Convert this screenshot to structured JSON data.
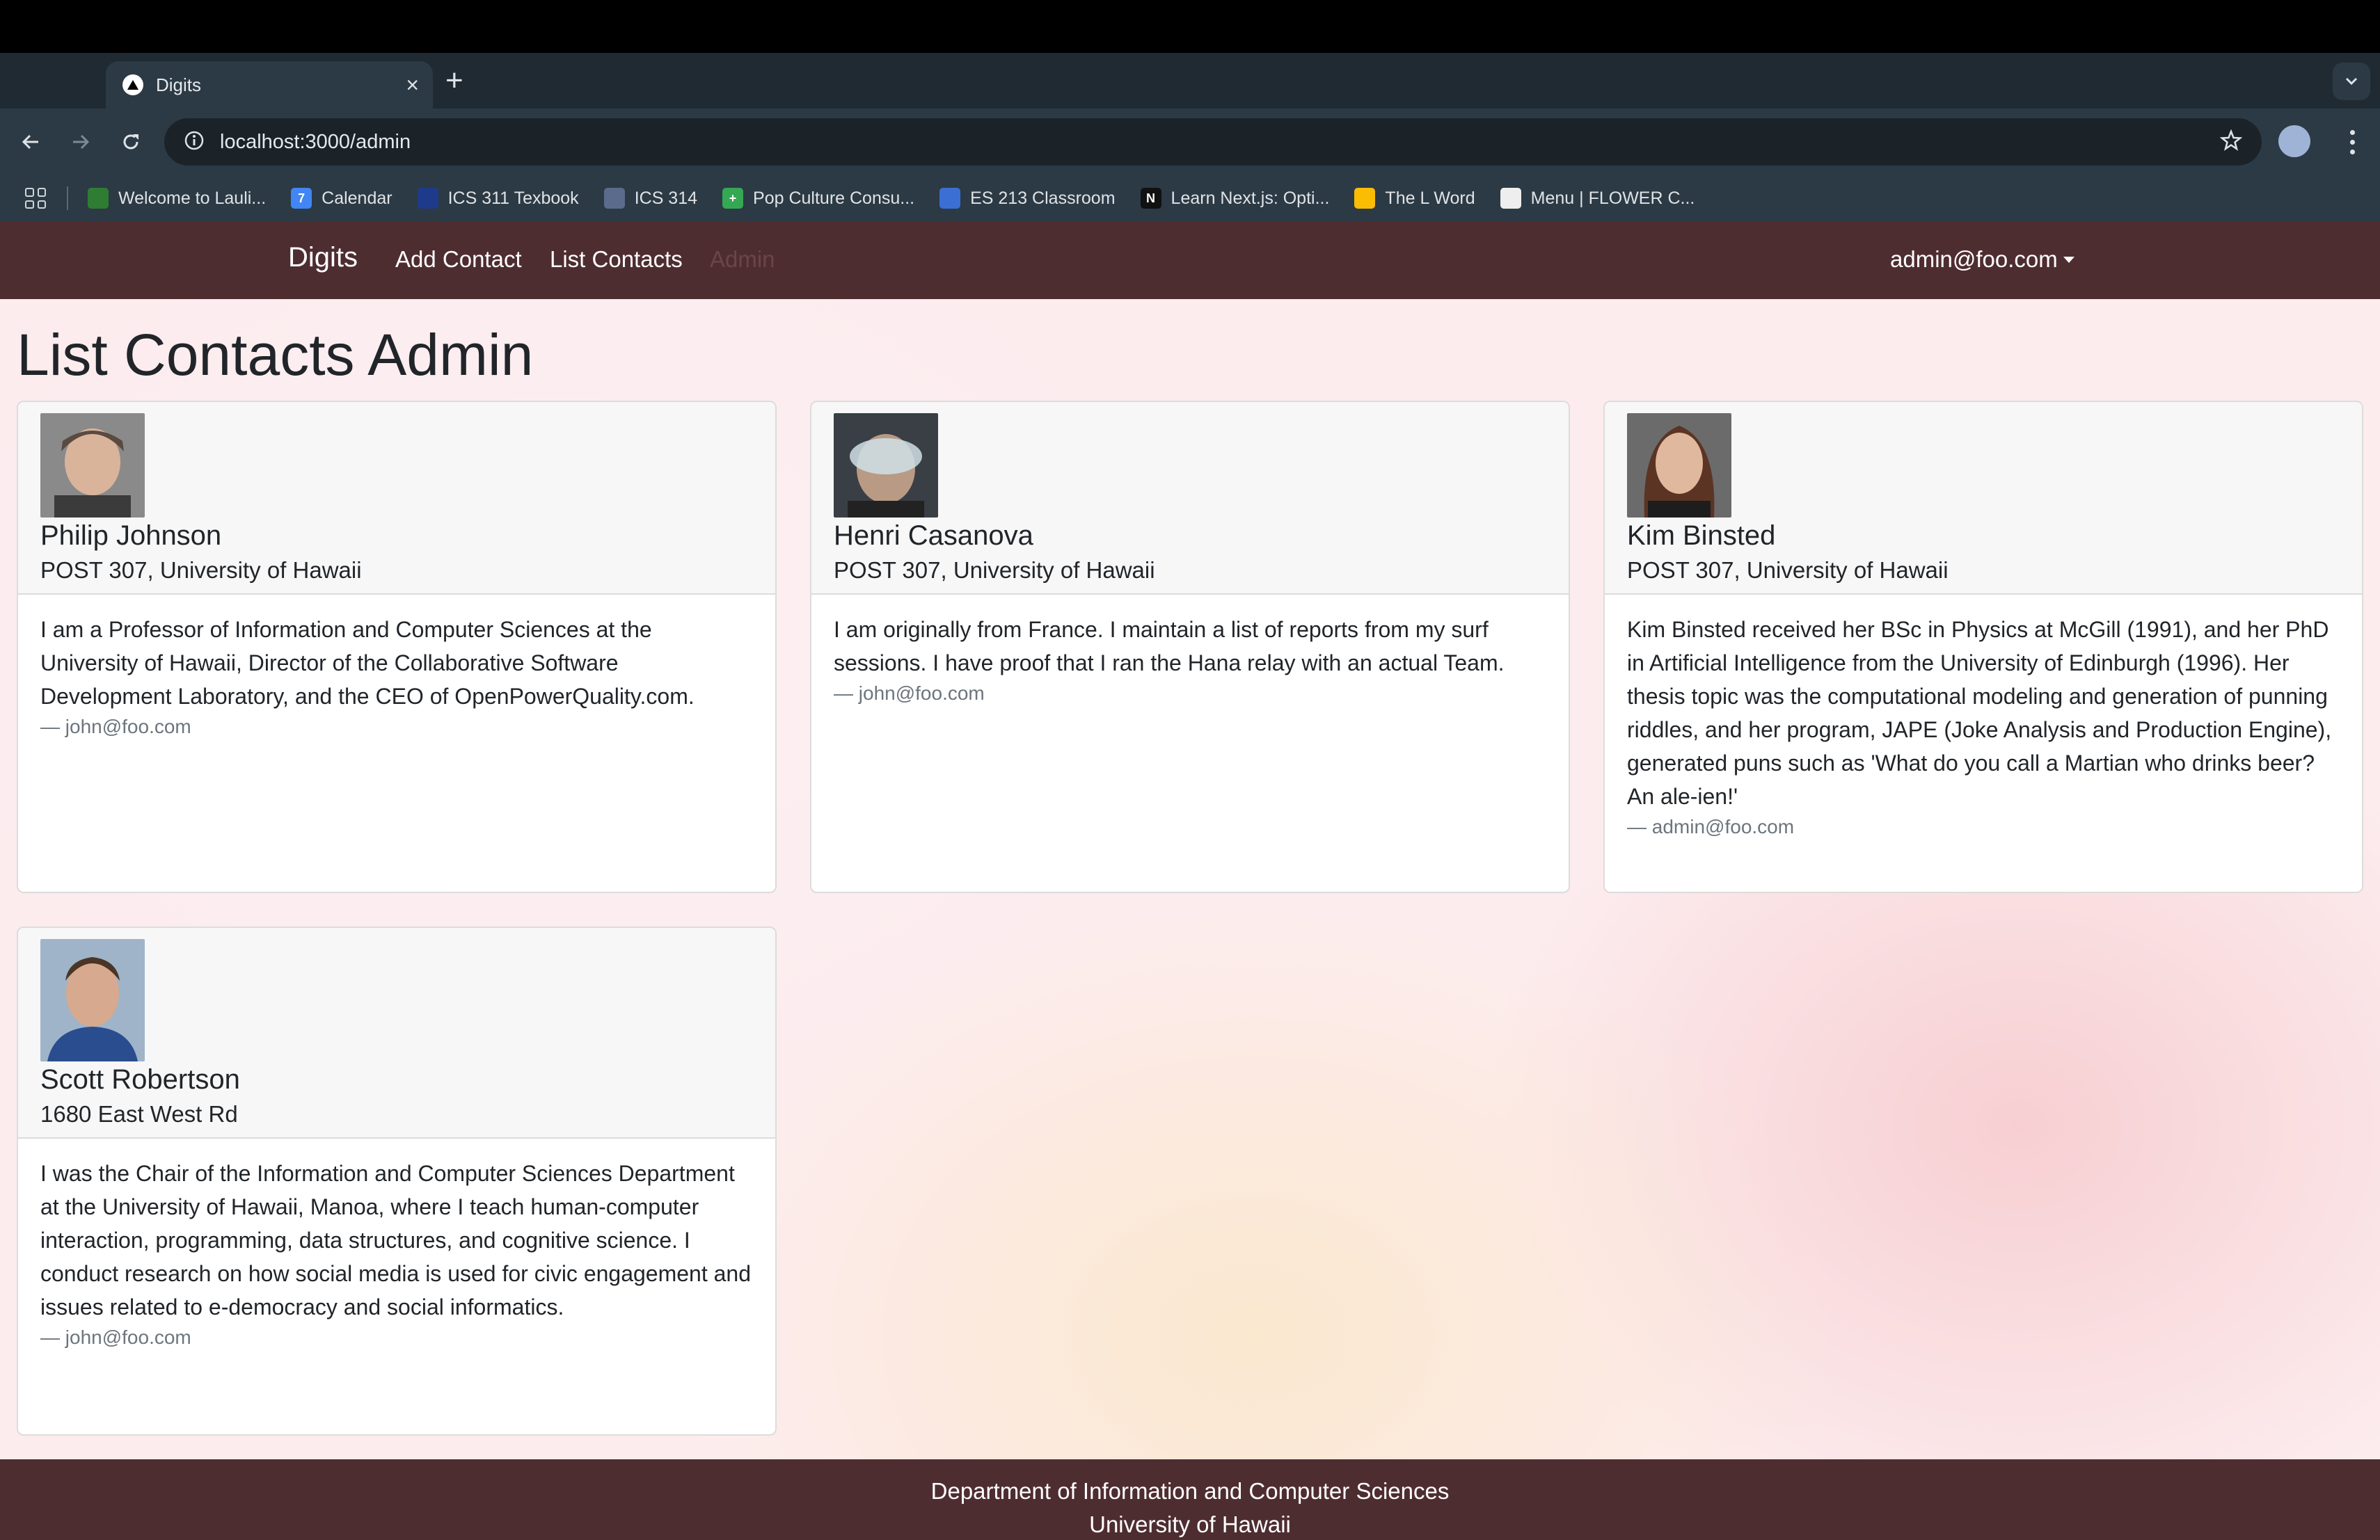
{
  "browser": {
    "tab_title": "Digits",
    "url": "localhost:3000/admin",
    "bookmarks": [
      {
        "label": "Welcome to Lauli...",
        "color": "#2e7d32"
      },
      {
        "label": "Calendar",
        "color": "#4285f4",
        "glyph": "7"
      },
      {
        "label": "ICS 311 Texbook",
        "color": "#1e3a8a"
      },
      {
        "label": "ICS 314",
        "color": "#5b6b8c"
      },
      {
        "label": "Pop Culture Consu...",
        "color": "#34a853",
        "glyph": "+"
      },
      {
        "label": "ES 213 Classroom",
        "color": "#3b6fd4"
      },
      {
        "label": "Learn Next.js: Opti...",
        "color": "#111111",
        "glyph": "N"
      },
      {
        "label": "The L Word",
        "color": "#fbbc04"
      },
      {
        "label": "Menu | FLOWER C...",
        "color": "#eeeeee"
      }
    ]
  },
  "navbar": {
    "brand": "Digits",
    "links": [
      "Add Contact",
      "List Contacts",
      "Admin"
    ],
    "user": "admin@foo.com"
  },
  "page": {
    "title": "List Contacts Admin"
  },
  "contacts": [
    {
      "name": "Philip Johnson",
      "address": "POST 307, University of Hawaii",
      "description": "I am a Professor of Information and Computer Sciences at the University of Hawaii, Director of the Collaborative Software Development Laboratory, and the CEO of OpenPowerQuality.com.",
      "owner": "— john@foo.com"
    },
    {
      "name": "Henri Casanova",
      "address": "POST 307, University of Hawaii",
      "description": "I am originally from France. I maintain a list of reports from my surf sessions. I have proof that I ran the Hana relay with an actual Team.",
      "owner": "— john@foo.com"
    },
    {
      "name": "Kim Binsted",
      "address": "POST 307, University of Hawaii",
      "description": "Kim Binsted received her BSc in Physics at McGill (1991), and her PhD in Artificial Intelligence from the University of Edinburgh (1996). Her thesis topic was the computational modeling and generation of punning riddles, and her program, JAPE (Joke Analysis and Production Engine), generated puns such as 'What do you call a Martian who drinks beer? An ale-ien!'",
      "owner": "— admin@foo.com"
    },
    {
      "name": "Scott Robertson",
      "address": "1680 East West Rd",
      "description": "I was the Chair of the Information and Computer Sciences Department at the University of Hawaii, Manoa, where I teach human-computer interaction, programming, data structures, and cognitive science. I conduct research on how social media is used for civic engagement and issues related to e-democracy and social informatics.",
      "owner": "— john@foo.com"
    }
  ],
  "footer": {
    "line1": "Department of Information and Computer Sciences",
    "line2": "University of Hawaii"
  }
}
